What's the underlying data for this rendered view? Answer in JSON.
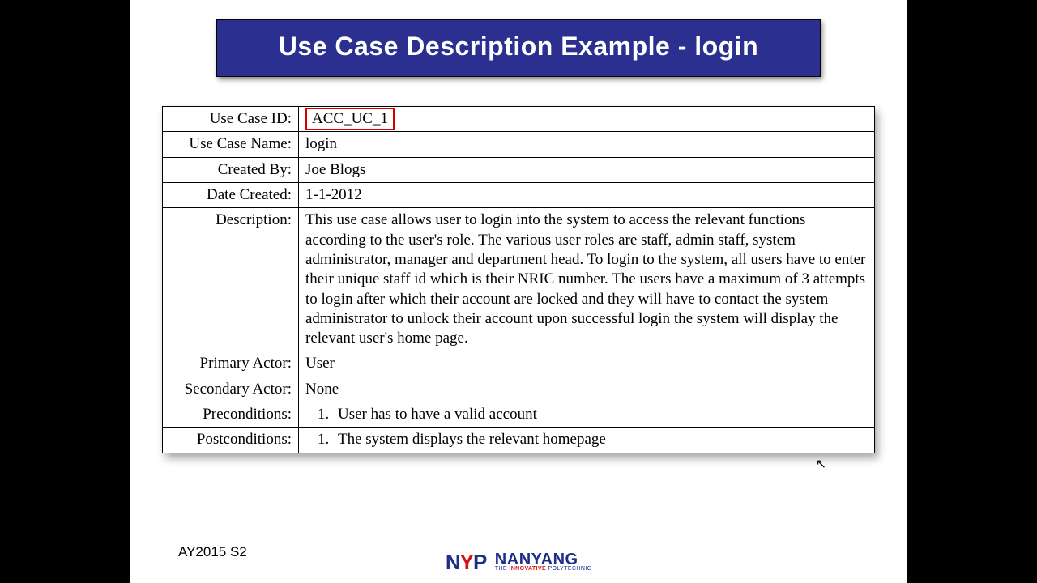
{
  "title": "Use Case Description Example - login",
  "rows": {
    "use_case_id": {
      "label": "Use Case ID:",
      "value": "ACC_UC_1"
    },
    "use_case_name": {
      "label": "Use Case Name:",
      "value": "login"
    },
    "created_by": {
      "label": "Created By:",
      "value": "Joe Blogs"
    },
    "date_created": {
      "label": "Date Created:",
      "value": "1-1-2012"
    },
    "description": {
      "label": "Description:",
      "value": "This use case allows user to login into the system to access the relevant functions according to the user's role. The various user roles are staff, admin staff, system administrator, manager and department head. To login to the system, all users have to enter their unique staff id which is their NRIC number. The users have a maximum of 3 attempts to login after which their account are locked and they will have to contact the system administrator to unlock their account upon successful login the system will display the relevant user's home page."
    },
    "primary_actor": {
      "label": "Primary Actor:",
      "value": "User"
    },
    "secondary_actor": {
      "label": "Secondary Actor:",
      "value": "None"
    },
    "preconditions": {
      "label": "Preconditions:",
      "value": "User has to have a valid account"
    },
    "postconditions": {
      "label": "Postconditions:",
      "value": "The system displays the relevant homepage"
    }
  },
  "footer": "AY2015 S2",
  "logo": {
    "initials_n": "N",
    "initials_y": "Y",
    "initials_p": "P",
    "line1": "NANYANG",
    "line2_a": "THE ",
    "line2_b": "INNOVATIVE",
    "line2_c": " POLYTECHNIC"
  }
}
